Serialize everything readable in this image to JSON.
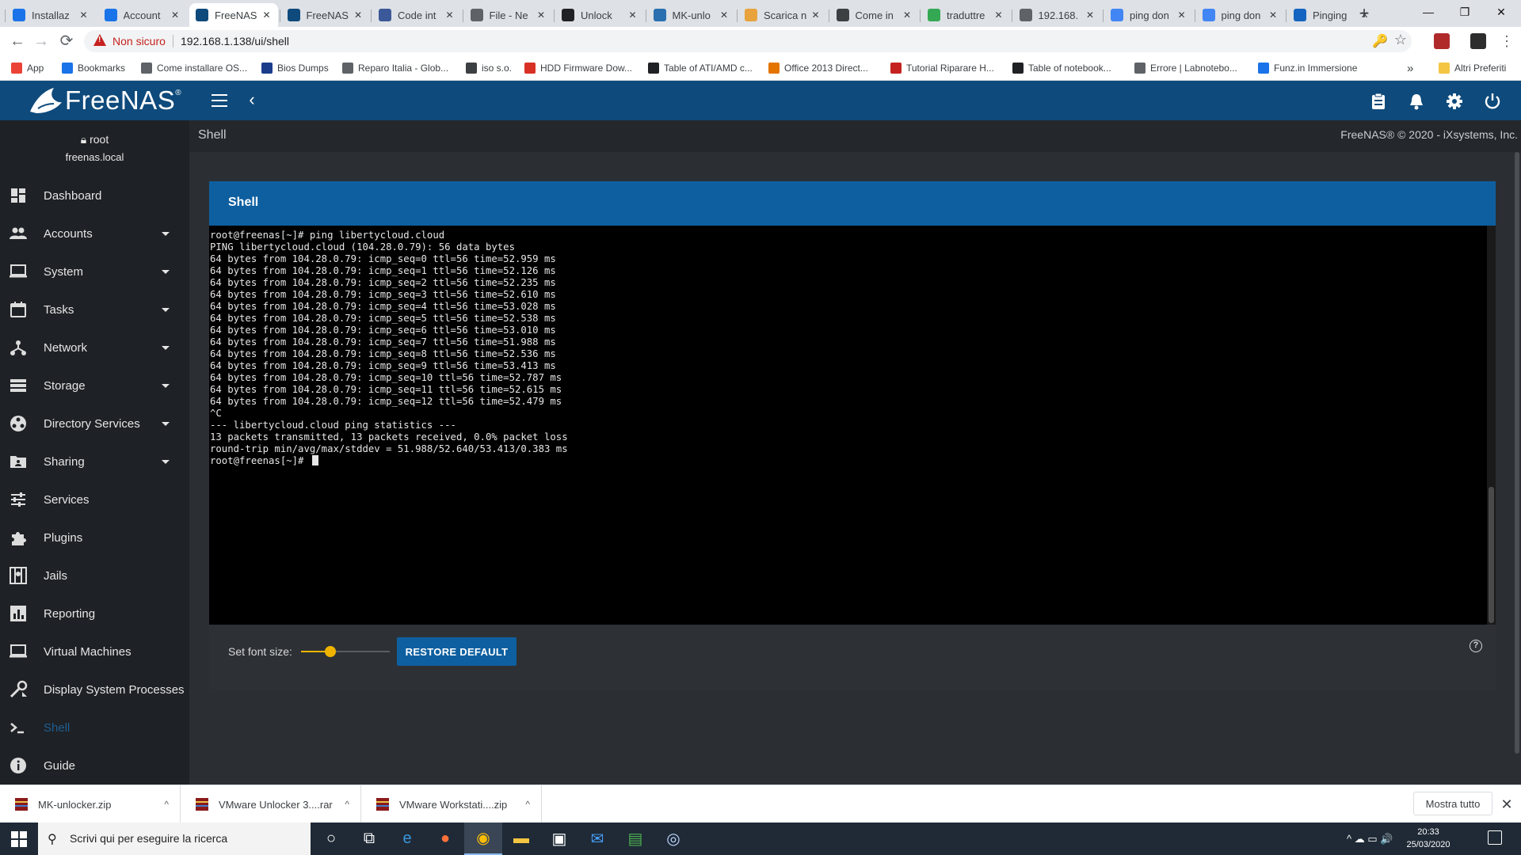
{
  "browser": {
    "tabs": [
      {
        "label": "Installaz",
        "color": "#1a73e8"
      },
      {
        "label": "Account",
        "color": "#1a73e8"
      },
      {
        "label": "FreeNAS",
        "color": "#0e4a7b"
      },
      {
        "label": "FreeNAS",
        "color": "#0e4a7b"
      },
      {
        "label": "Code int",
        "color": "#3b5998"
      },
      {
        "label": "File - Ne",
        "color": "#5f6368"
      },
      {
        "label": "Unlock",
        "color": "#202124"
      },
      {
        "label": "MK-unlo",
        "color": "#2a6fb0"
      },
      {
        "label": "Scarica n",
        "color": "#e8a33d"
      },
      {
        "label": "Come in",
        "color": "#3c4043"
      },
      {
        "label": "traduttre",
        "color": "#34a853"
      },
      {
        "label": "192.168.",
        "color": "#5f6368"
      },
      {
        "label": "ping don",
        "color": "#4285f4"
      },
      {
        "label": "ping don",
        "color": "#4285f4"
      },
      {
        "label": "Pinging",
        "color": "#1565c0"
      }
    ],
    "new_tab": "+",
    "window": {
      "minimize": "—",
      "restore": "❐",
      "close": "✕"
    },
    "nav": {
      "back": "←",
      "forward": "→",
      "reload": "⟳"
    },
    "security_label": "Non sicuro",
    "url": "192.168.1.138/ui/shell",
    "key_icon": "🔑",
    "star_icon": "☆",
    "menu_icon": "⋮",
    "extensions": [
      {
        "name": "acrobat-extension-icon",
        "color": "#b02a2a"
      },
      {
        "name": "incognito-extension-icon",
        "color": "#2d2d2d"
      }
    ],
    "bookmarks": [
      {
        "label": "App",
        "color": "#ea4335"
      },
      {
        "label": "Bookmarks",
        "color": "#1a73e8"
      },
      {
        "label": "Come installare OS...",
        "color": "#5f6368"
      },
      {
        "label": "Bios Dumps",
        "color": "#1a3c8a"
      },
      {
        "label": "Reparo Italia - Glob...",
        "color": "#5f6368"
      },
      {
        "label": "iso s.o.",
        "color": "#3c4043"
      },
      {
        "label": "HDD Firmware Dow...",
        "color": "#d93025"
      },
      {
        "label": "Table of ATI/AMD c...",
        "color": "#202124"
      },
      {
        "label": "Office 2013 Direct...",
        "color": "#e37400"
      },
      {
        "label": "Tutorial Riparare H...",
        "color": "#c5221f"
      },
      {
        "label": "Table of notebook...",
        "color": "#202124"
      },
      {
        "label": "Errore | Labnotebo...",
        "color": "#5f6368"
      },
      {
        "label": "Funz.in Immersione",
        "color": "#1a73e8"
      }
    ],
    "bookmarks_more": "»",
    "other_bookmarks": "Altri Preferiti"
  },
  "app": {
    "brand": "FreeNAS",
    "brand_reg": "®",
    "colors": {
      "topbar": "#0e4a7b",
      "accent": "#0e5fa0",
      "active_nav": "#1f5f92",
      "slider": "#f0b400"
    }
  },
  "user": {
    "name": "root",
    "host": "freenas.local"
  },
  "sidebar": {
    "items": [
      {
        "label": "Dashboard",
        "icon": "dashboard-icon",
        "has_caret": false
      },
      {
        "label": "Accounts",
        "icon": "accounts-icon",
        "has_caret": true
      },
      {
        "label": "System",
        "icon": "system-icon",
        "has_caret": true
      },
      {
        "label": "Tasks",
        "icon": "tasks-icon",
        "has_caret": true
      },
      {
        "label": "Network",
        "icon": "network-icon",
        "has_caret": true
      },
      {
        "label": "Storage",
        "icon": "storage-icon",
        "has_caret": true
      },
      {
        "label": "Directory Services",
        "icon": "directory-services-icon",
        "has_caret": true
      },
      {
        "label": "Sharing",
        "icon": "sharing-icon",
        "has_caret": true
      },
      {
        "label": "Services",
        "icon": "services-icon",
        "has_caret": false
      },
      {
        "label": "Plugins",
        "icon": "plugins-icon",
        "has_caret": false
      },
      {
        "label": "Jails",
        "icon": "jails-icon",
        "has_caret": false
      },
      {
        "label": "Reporting",
        "icon": "reporting-icon",
        "has_caret": false
      },
      {
        "label": "Virtual Machines",
        "icon": "virtual-machines-icon",
        "has_caret": false
      },
      {
        "label": "Display System Processes",
        "icon": "display-system-processes-icon",
        "has_caret": false
      },
      {
        "label": "Shell",
        "icon": "shell-icon",
        "has_caret": false,
        "active": true
      },
      {
        "label": "Guide",
        "icon": "guide-icon",
        "has_caret": false
      }
    ]
  },
  "page": {
    "title": "Shell",
    "copyright": "FreeNAS® © 2020 - iXsystems, Inc."
  },
  "shell": {
    "card_title": "Shell",
    "lines": [
      "root@freenas[~]# ping libertycloud.cloud",
      "PING libertycloud.cloud (104.28.0.79): 56 data bytes",
      "64 bytes from 104.28.0.79: icmp_seq=0 ttl=56 time=52.959 ms",
      "64 bytes from 104.28.0.79: icmp_seq=1 ttl=56 time=52.126 ms",
      "64 bytes from 104.28.0.79: icmp_seq=2 ttl=56 time=52.235 ms",
      "64 bytes from 104.28.0.79: icmp_seq=3 ttl=56 time=52.610 ms",
      "64 bytes from 104.28.0.79: icmp_seq=4 ttl=56 time=53.028 ms",
      "64 bytes from 104.28.0.79: icmp_seq=5 ttl=56 time=52.538 ms",
      "64 bytes from 104.28.0.79: icmp_seq=6 ttl=56 time=53.010 ms",
      "64 bytes from 104.28.0.79: icmp_seq=7 ttl=56 time=51.988 ms",
      "64 bytes from 104.28.0.79: icmp_seq=8 ttl=56 time=52.536 ms",
      "64 bytes from 104.28.0.79: icmp_seq=9 ttl=56 time=53.413 ms",
      "64 bytes from 104.28.0.79: icmp_seq=10 ttl=56 time=52.787 ms",
      "64 bytes from 104.28.0.79: icmp_seq=11 ttl=56 time=52.615 ms",
      "64 bytes from 104.28.0.79: icmp_seq=12 ttl=56 time=52.479 ms",
      "^C",
      "--- libertycloud.cloud ping statistics ---",
      "13 packets transmitted, 13 packets received, 0.0% packet loss",
      "round-trip min/avg/max/stddev = 51.988/52.640/53.413/0.383 ms",
      "root@freenas[~]# "
    ],
    "font_size_label": "Set font size:",
    "font_size_fraction": 0.33,
    "restore_label": "RESTORE DEFAULT",
    "help_label": "?"
  },
  "downloads": {
    "items": [
      {
        "name": "MK-unlocker.zip",
        "color": "#8b1a1a"
      },
      {
        "name": "VMware Unlocker 3....rar",
        "color": "#8b1a1a"
      },
      {
        "name": "VMware Workstati....zip",
        "color": "#8b1a1a"
      }
    ],
    "caret": "^",
    "show_all": "Mostra tutto",
    "close": "✕"
  },
  "taskbar": {
    "search_placeholder": "Scrivi qui per eseguire la ricerca",
    "search_icon": "⚲",
    "apps": [
      {
        "name": "cortana-icon",
        "glyph": "○",
        "color": "#ffffff",
        "active": false
      },
      {
        "name": "task-view-icon",
        "glyph": "⧉",
        "color": "#ffffff",
        "active": false
      },
      {
        "name": "edge-icon",
        "glyph": "e",
        "color": "#3a96dd",
        "active": false
      },
      {
        "name": "firefox-icon",
        "glyph": "●",
        "color": "#ff7139",
        "active": false
      },
      {
        "name": "chrome-icon",
        "glyph": "◉",
        "color": "#fbbc04",
        "active": true
      },
      {
        "name": "file-explorer-icon",
        "glyph": "▬",
        "color": "#f4c542",
        "active": false
      },
      {
        "name": "store-icon",
        "glyph": "▣",
        "color": "#ffffff",
        "active": false
      },
      {
        "name": "mail-icon",
        "glyph": "✉",
        "color": "#4aa0ff",
        "active": false
      },
      {
        "name": "app-icon",
        "glyph": "▤",
        "color": "#4caf50",
        "active": false
      },
      {
        "name": "network-tool-icon",
        "glyph": "◎",
        "color": "#bcd6ff",
        "active": false
      }
    ],
    "tray_icons": "^  ☁  ▭  🔊",
    "time": "20:33",
    "date": "25/03/2020"
  }
}
